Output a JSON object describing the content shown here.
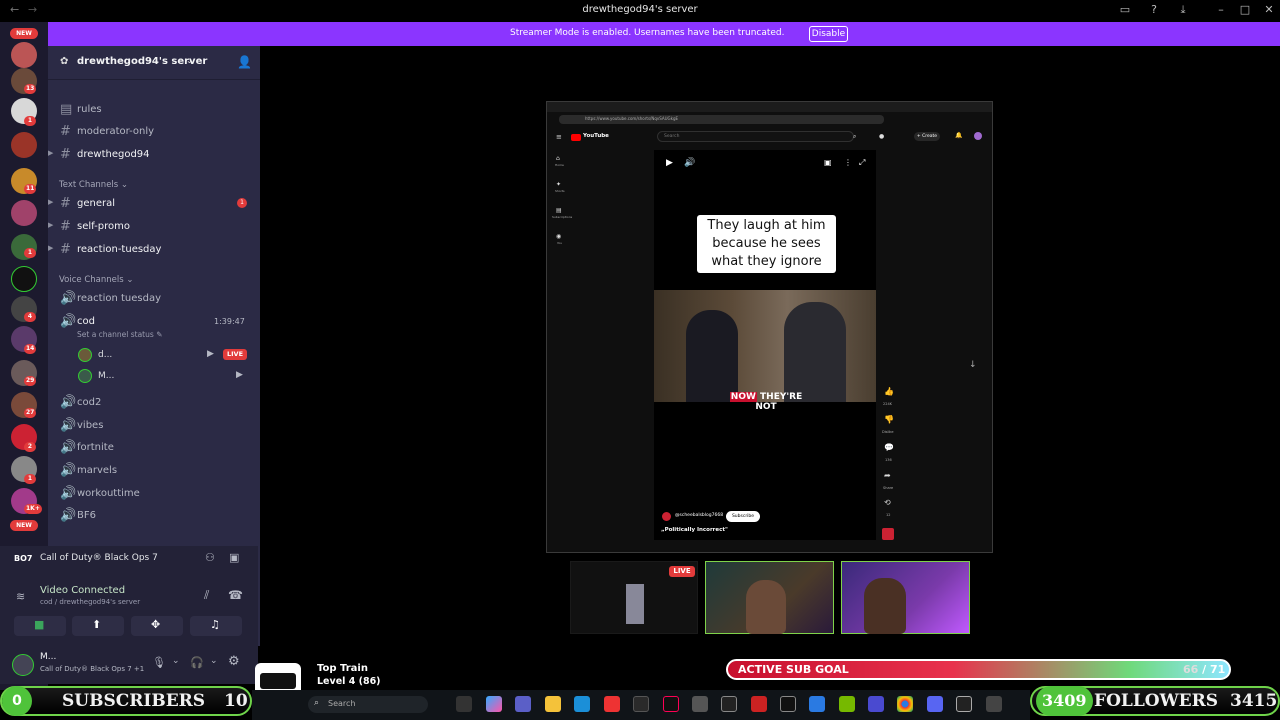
{
  "window": {
    "title": "drewthegod94's server"
  },
  "banner": {
    "text": "Streamer Mode is enabled. Usernames have been truncated.",
    "button": "Disable"
  },
  "server_rail": {
    "new_label": "NEW",
    "badges": [
      "4",
      "13",
      "1",
      "11",
      "1",
      "1",
      "4",
      "14",
      "29",
      "27",
      "2",
      "1",
      "1K+",
      "1"
    ]
  },
  "server": {
    "name": "drewthegod94's server"
  },
  "channels": {
    "top": [
      "rules",
      "moderator-only",
      "drewthegod94"
    ],
    "text_category": "Text Channels",
    "text": [
      {
        "name": "general",
        "badge": "1"
      },
      {
        "name": "self-promo"
      },
      {
        "name": "reaction-tuesday"
      }
    ],
    "voice_category": "Voice Channels",
    "voice_top": [
      "reaction tuesday"
    ],
    "active_voice": {
      "name": "cod",
      "timer": "1:39:47",
      "status": "Set a channel status"
    },
    "members": [
      {
        "name": "d...",
        "live": "LIVE"
      },
      {
        "name": "M..."
      }
    ],
    "voice_rest": [
      "cod2",
      "vibes",
      "fortnite",
      "marvels",
      "workouttime",
      "BF6"
    ]
  },
  "activity": {
    "game": "Call of Duty® Black Ops 7"
  },
  "voice_status": {
    "title": "Video Connected",
    "subtitle": "cod / drewthegod94's server"
  },
  "user": {
    "name": "M...",
    "status": "Call of Duty® Black Ops 7 +1"
  },
  "browser": {
    "url": "https://www.youtube.com/shorts/NqvSAUGkgE",
    "search_placeholder": "Search",
    "brand": "YouTube",
    "create": "+ Create",
    "nav": [
      "Home",
      "Shorts",
      "Subscriptions",
      "You"
    ]
  },
  "video": {
    "caption": "They laugh at him because he sees what they ignore",
    "subtitle_hl": "NOW",
    "subtitle_rest": "THEY'RE NOT",
    "channel": "@scheebalsblog7668",
    "subscribe": "Subscribe",
    "title": "„Politically Incorrect\"",
    "likes": "224K",
    "dislike": "Dislike",
    "comments": "136",
    "share": "Share",
    "remix": "12"
  },
  "live_label": "LIVE",
  "overlay": {
    "top_train_title": "Top Train",
    "top_train_level": "Level 4 (86)",
    "sub_goal_label": "ACTIVE SUB GOAL",
    "sub_goal_current": "66",
    "sub_goal_total": "/ 71",
    "sub_goal_fraction": 0.93,
    "subscribers_left": "0",
    "subscribers_label": "SUBSCRIBERS",
    "subscribers_right": "10",
    "followers_left": "3409",
    "followers_label": "FOLLOWERS",
    "followers_right": "3415"
  },
  "taskbar": {
    "search": "Search"
  },
  "colors": {
    "accent": "#8b35ff",
    "live": "#e23b3b",
    "sidebar": "#2b2a45",
    "green": "#6fd34a"
  }
}
